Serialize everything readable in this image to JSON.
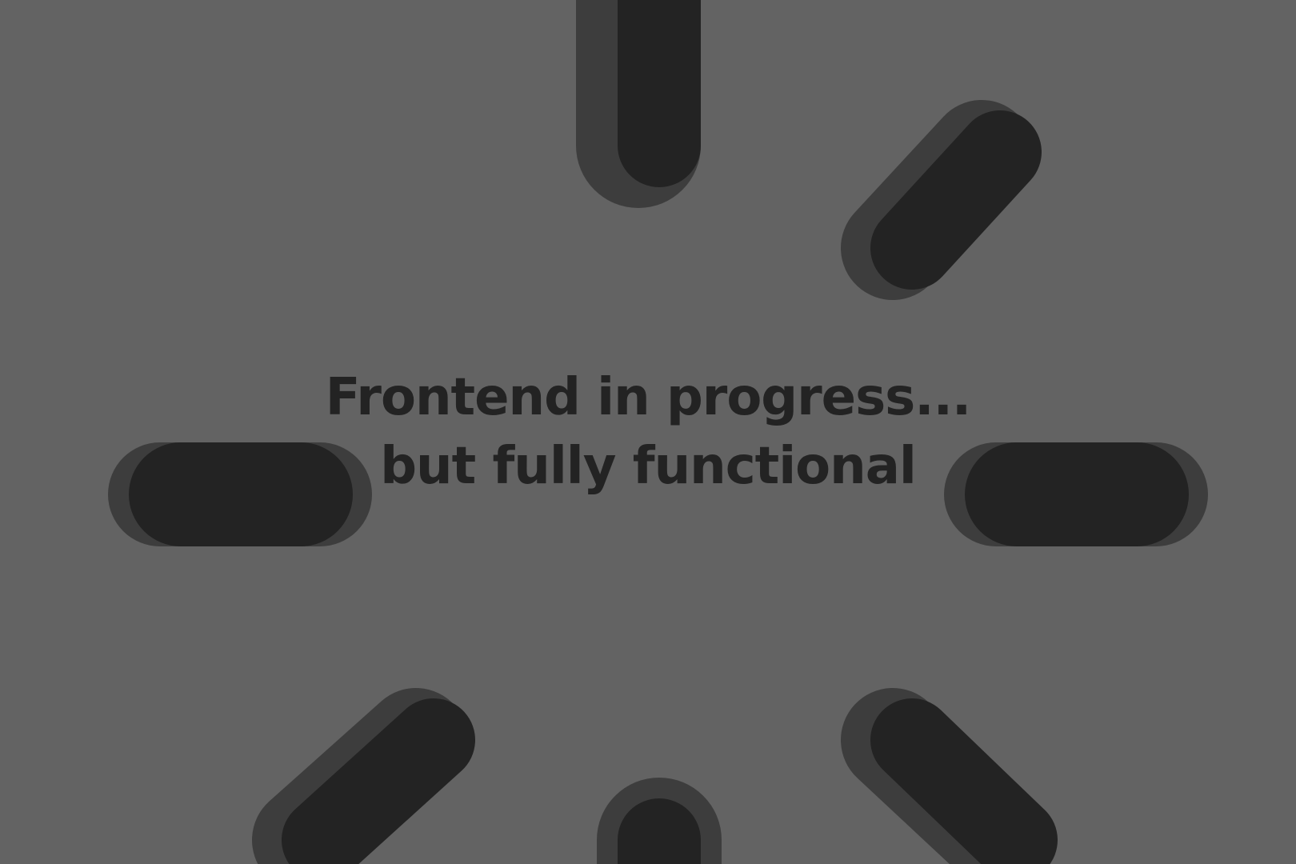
{
  "loader": {
    "icon": "spinner-icon",
    "headline": "Frontend in progress...",
    "subline": "but fully functional"
  },
  "colors": {
    "background": "#636363",
    "shadow": "#3d3d3d",
    "spoke": "#232323",
    "text": "#232323"
  }
}
